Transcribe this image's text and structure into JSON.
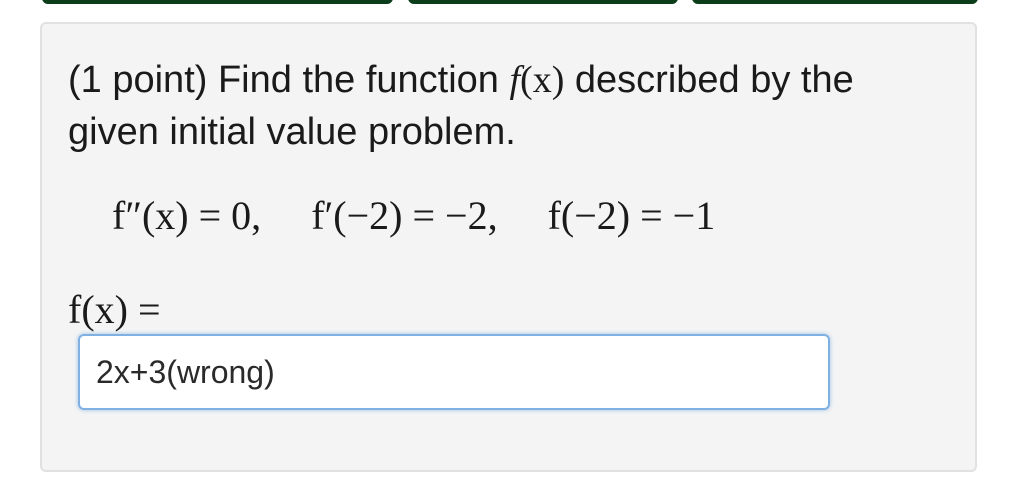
{
  "problem": {
    "prompt_prefix": "(1 point) Find the function ",
    "prompt_func": "f",
    "prompt_arg": "(x)",
    "prompt_suffix": " described by the given initial value problem.",
    "eq1": "f″(x) = 0,",
    "eq2": "f′(−2) = −2,",
    "eq3": "f(−2) = −1",
    "answer_label": "f(x) =",
    "answer_value": "2x+3(wrong)"
  }
}
